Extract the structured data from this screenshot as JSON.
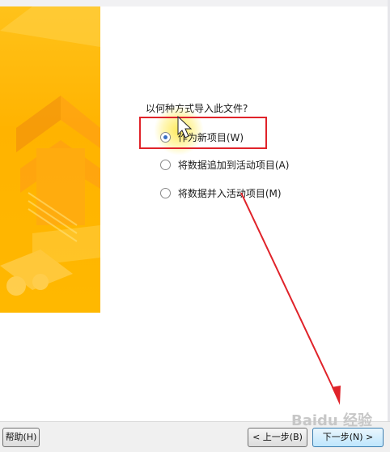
{
  "dialog": {
    "question": "以何种方式导入此文件?",
    "options": [
      {
        "label": "作为新项目(W)",
        "selected": true
      },
      {
        "label": "将数据追加到活动项目(A)",
        "selected": false
      },
      {
        "label": "将数据并入活动项目(M)",
        "selected": false
      }
    ]
  },
  "buttons": {
    "help": "帮助(H)",
    "back": "< 上一步(B)",
    "next": "下一步(N) >"
  },
  "colors": {
    "accent_panel": "#ffb300",
    "annotation_red": "#e0232a"
  },
  "watermark": "Baidu 经验"
}
